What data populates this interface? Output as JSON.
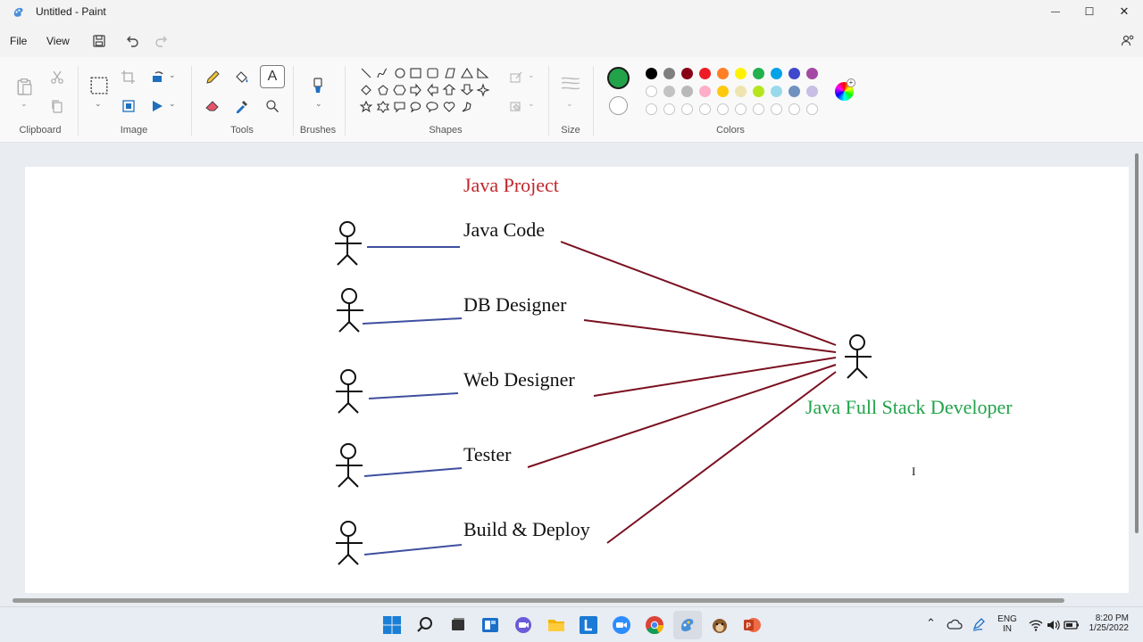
{
  "window": {
    "title": "Untitled - Paint",
    "minimize": "—",
    "maximize": "☐",
    "close": "✕"
  },
  "menu": {
    "file": "File",
    "view": "View"
  },
  "ribbon": {
    "clipboard": "Clipboard",
    "image": "Image",
    "tools": "Tools",
    "brushes": "Brushes",
    "shapes": "Shapes",
    "size": "Size",
    "colors": "Colors",
    "text_tool": "A"
  },
  "palette": {
    "primary": "#22a34a",
    "secondary": "#ffffff",
    "row1": [
      "#000000",
      "#7f7f7f",
      "#880015",
      "#ed1c24",
      "#ff7f27",
      "#fff200",
      "#22b14c",
      "#00a2e8",
      "#3f48cc",
      "#a349a4"
    ],
    "row2": [
      "#ffffff",
      "#c3c3c3",
      "#b9b9b9",
      "#ffaec9",
      "#ffc90e",
      "#efe4b0",
      "#b5e61d",
      "#99d9ea",
      "#7092be",
      "#c8bfe7"
    ]
  },
  "diagram": {
    "title": "Java Project",
    "title_color": "#c1272d",
    "roles": [
      "Java Code",
      "DB Designer",
      "Web Designer",
      "Tester",
      "Build & Deploy"
    ],
    "developer": "Java Full Stack Developer",
    "developer_color": "#22a34a",
    "blue_line_color": "#3f4fa0",
    "red_line_color": "#7a1020"
  },
  "taskbar": {
    "language_line1": "ENG",
    "language_line2": "IN",
    "time": "8:20 PM",
    "date": "1/25/2022"
  }
}
